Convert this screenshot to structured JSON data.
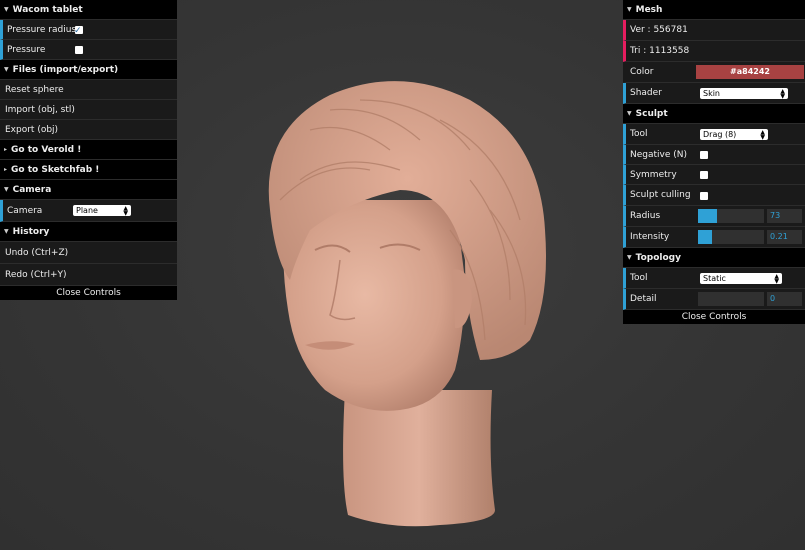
{
  "left_panel": {
    "wacom": {
      "title": "Wacom tablet",
      "pressure_radius_label": "Pressure radius",
      "pressure_radius_checked": true,
      "pressure_label": "Pressure",
      "pressure_checked": false
    },
    "files": {
      "title": "Files (import/export)",
      "reset_sphere": "Reset sphere",
      "import": "Import (obj, stl)",
      "export": "Export (obj)"
    },
    "verold": "Go to Verold !",
    "sketchfab": "Go to Sketchfab !",
    "camera": {
      "title": "Camera",
      "camera_label": "Camera",
      "camera_value": "Plane"
    },
    "history": {
      "title": "History",
      "undo": "Undo (Ctrl+Z)",
      "redo": "Redo (Ctrl+Y)"
    },
    "close": "Close Controls"
  },
  "right_panel": {
    "mesh": {
      "title": "Mesh",
      "vertices": "Ver : 556781",
      "triangles": "Tri : 1113558",
      "color_label": "Color",
      "color_value": "#a84242",
      "shader_label": "Shader",
      "shader_value": "Skin"
    },
    "sculpt": {
      "title": "Sculpt",
      "tool_label": "Tool",
      "tool_value": "Drag (8)",
      "negative_label": "Negative (N)",
      "negative_checked": false,
      "symmetry_label": "Symmetry",
      "symmetry_checked": false,
      "culling_label": "Sculpt culling",
      "culling_checked": false,
      "radius_label": "Radius",
      "radius_value": "73",
      "radius_fraction": 0.29,
      "intensity_label": "Intensity",
      "intensity_value": "0.21",
      "intensity_fraction": 0.21
    },
    "topology": {
      "title": "Topology",
      "tool_label": "Tool",
      "tool_value": "Static",
      "detail_label": "Detail",
      "detail_value": "0"
    },
    "close": "Close Controls"
  },
  "colors": {
    "panel_bg": "#1a1a1a",
    "number_accent": "#2fa1d6",
    "string_accent": "#e61d5f",
    "mesh_color": "#a84242",
    "viewport_bg": "#353535"
  }
}
